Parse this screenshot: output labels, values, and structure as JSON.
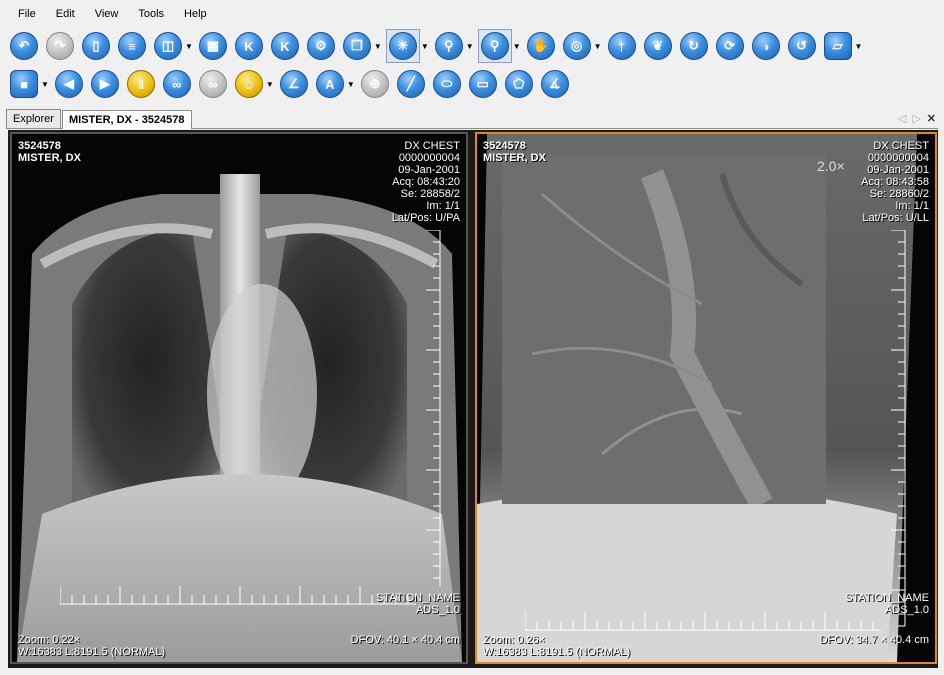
{
  "menu": {
    "items": [
      "File",
      "Edit",
      "View",
      "Tools",
      "Help"
    ]
  },
  "toolbar1": {
    "icons": [
      "back-arrow-icon",
      "forward-arrow-icon",
      "clipboard-icon",
      "layout-row-icon",
      "layout-split-icon",
      "key-grid-icon",
      "key-image-icon",
      "key-film-icon",
      "film-reel-icon",
      "copy-stack-icon",
      "window-level-icon",
      "zoom-icon",
      "magnify-icon",
      "hand-pan-icon",
      "roi-icon",
      "body-single-icon",
      "lungs-icon",
      "body-rotate-icon",
      "body-cycle-icon",
      "invert-icon",
      "undo-icon",
      "reset-view-icon"
    ]
  },
  "toolbar2": {
    "icons": [
      "stop-icon",
      "prev-icon",
      "next-icon",
      "sync-icon",
      "link-icon",
      "link-disabled-icon",
      "head-icon",
      "angle-icon",
      "text-annotation-icon",
      "crosshair-icon",
      "line-measure-icon",
      "ellipse-measure-icon",
      "rect-measure-icon",
      "polygon-measure-icon",
      "cobb-angle-icon"
    ],
    "text_annotation_label": "A"
  },
  "tabs": [
    {
      "label": "Explorer"
    },
    {
      "label": "MISTER, DX - 3524578"
    }
  ],
  "viewports": [
    {
      "patient_id": "3524578",
      "patient_name": "MISTER, DX",
      "modality": "DX CHEST",
      "accession": "0000000004",
      "study_date": "09-Jan-2001",
      "acq": "Acq: 08:43:20",
      "series": "Se: 28858/2",
      "image": "Im: 1/1",
      "lat_pos": "Lat/Pos: U/PA",
      "station": "STATION_NAME",
      "ads": "ADS_1.0",
      "zoom": "Zoom: 0.22×",
      "wl": "W:16383 L:8191.5 (NORMAL)",
      "dfov": "DFOV: 40.1 × 40.4 cm"
    },
    {
      "patient_id": "3524578",
      "patient_name": "MISTER, DX",
      "modality": "DX CHEST",
      "accession": "0000000004",
      "study_date": "09-Jan-2001",
      "acq": "Acq: 08:43:58",
      "series": "Se: 28860/2",
      "image": "Im: 1/1",
      "lat_pos": "Lat/Pos: U/LL",
      "station": "STATION_NAME",
      "ads": "ADS_1.0",
      "zoom": "Zoom: 0.26×",
      "wl": "W:16383 L:8191.5 (NORMAL)",
      "dfov": "DFOV: 34.7 × 40.4 cm",
      "magnifier_label": "2.0×"
    }
  ],
  "colors": {
    "active_viewport_border": "#e08a1e",
    "button_blue": "#3b8fe0"
  }
}
